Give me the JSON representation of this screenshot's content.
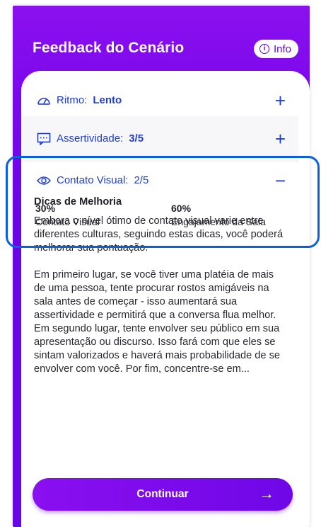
{
  "header": {
    "title": "Feedback do Cenário",
    "info_label": "Info"
  },
  "sections": [
    {
      "label": "Ritmo:",
      "value": "Lento",
      "toggle": "+",
      "icon": "gauge-icon"
    },
    {
      "label": "Assertividade:",
      "value": "3/5",
      "toggle": "+",
      "icon": "chat-bubble-icon"
    },
    {
      "label": "Contato Visual:",
      "value": "2/5",
      "toggle": "−",
      "icon": "eye-icon"
    }
  ],
  "stats": [
    {
      "pct": "30%",
      "label": "Contato Visual"
    },
    {
      "pct": "60%",
      "label": "Engajamento da Sala"
    }
  ],
  "tips": {
    "title": "Dicas de Melhoria",
    "p1": "Embora o nível ótimo de contato visual varie entre diferentes culturas, seguindo estas dicas, você poderá melhorar sua pontuação.",
    "p2": "Em primeiro lugar, se você tiver uma platéia de mais de uma pessoa, tente procurar rostos amigáveis na sala antes de começar - isso aumentará sua assertividade e permitirá que a conversa flua melhor. Em segundo lugar, tente envolver seu público em sua apresentação ou discurso. Isso fará com que eles se sintam valorizados e haverá mais probabilidade de se envolver com você. Por fim, concentre-se em..."
  },
  "cta": {
    "label": "Continuar",
    "arrow": "→"
  },
  "colors": {
    "primary": "#7a08ec",
    "link": "#1f3fd1",
    "highlight": "#0b5fd9"
  }
}
